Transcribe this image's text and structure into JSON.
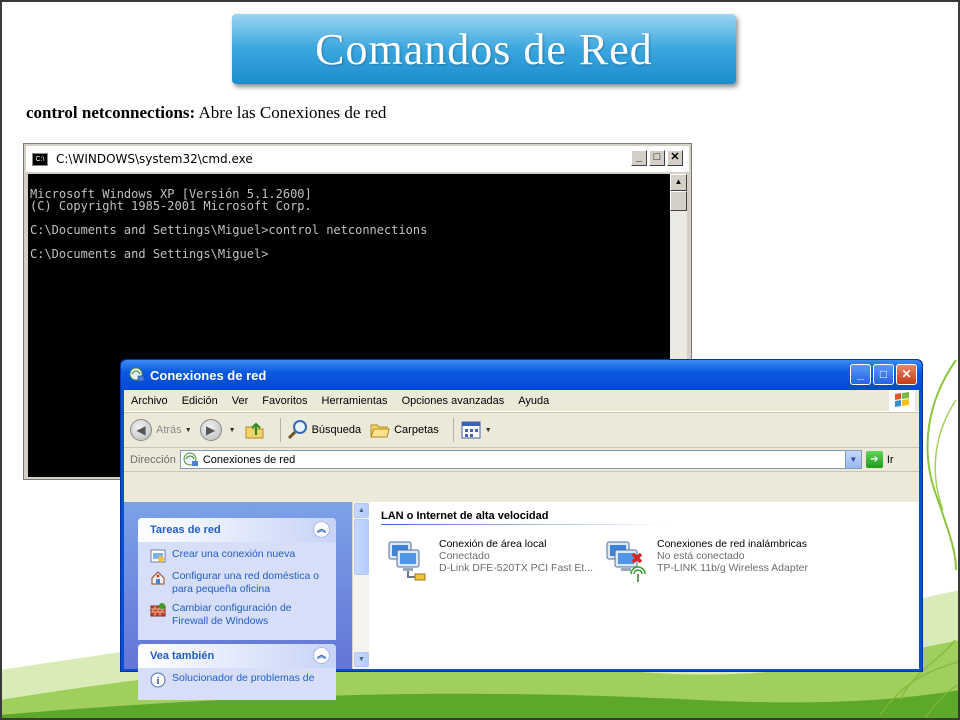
{
  "slide": {
    "title": "Comandos de Red",
    "subtitle_cmd": "control netconnections:",
    "subtitle_desc": " Abre las Conexiones de red"
  },
  "cmd": {
    "title": "C:\\WINDOWS\\system32\\cmd.exe",
    "lines": [
      "Microsoft Windows XP [Versión 5.1.2600]",
      "(C) Copyright 1985-2001 Microsoft Corp.",
      "",
      "C:\\Documents and Settings\\Miguel>control netconnections",
      "",
      "C:\\Documents and Settings\\Miguel>"
    ]
  },
  "netwin": {
    "title": "Conexiones de red",
    "menu": [
      "Archivo",
      "Edición",
      "Ver",
      "Favoritos",
      "Herramientas",
      "Opciones avanzadas",
      "Ayuda"
    ],
    "toolbar": {
      "back": "Atrás",
      "search": "Búsqueda",
      "folders": "Carpetas"
    },
    "address": {
      "label": "Dirección",
      "value": "Conexiones de red",
      "go": "Ir"
    },
    "tasks": {
      "header": "Tareas de red",
      "items": [
        "Crear una conexión nueva",
        "Configurar una red doméstica o para pequeña oficina",
        "Cambiar configuración de Firewall de Windows"
      ]
    },
    "see_also": {
      "header": "Vea también",
      "items": [
        "Solucionador de problemas de"
      ]
    },
    "group_header": "LAN o Internet de alta velocidad",
    "connections": [
      {
        "name": "Conexión de área local",
        "status": "Conectado",
        "device": "D-Link DFE-520TX PCI Fast Et..."
      },
      {
        "name": "Conexiones de red inalámbricas",
        "status": "No está conectado",
        "device": "TP-LINK 11b/g Wireless Adapter"
      }
    ]
  }
}
